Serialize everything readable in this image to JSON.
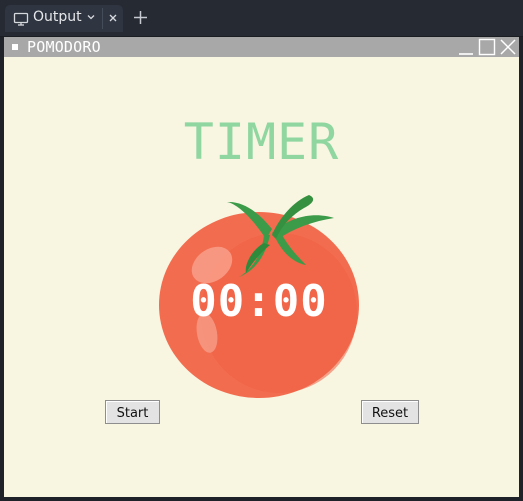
{
  "editor_tabs": {
    "active_tab": {
      "label": "Output",
      "icon": "monitor-icon"
    },
    "icons": {
      "dropdown": "chevron-down-icon",
      "close": "close-icon",
      "new_tab": "plus-icon"
    }
  },
  "window": {
    "title": "POMODORO",
    "controls": [
      "minimize-icon",
      "maximize-icon",
      "close-icon"
    ]
  },
  "app": {
    "heading": "TIMER",
    "timer_display": "00:00",
    "image": "tomato-image",
    "buttons": {
      "start_label": "Start",
      "reset_label": "Reset"
    }
  },
  "colors": {
    "background": "#f8f5e1",
    "heading": "#8fd6a0",
    "tomato": "#f26d4f",
    "leaves": "#3b9b48",
    "titlebar": "#a8a8a8"
  }
}
